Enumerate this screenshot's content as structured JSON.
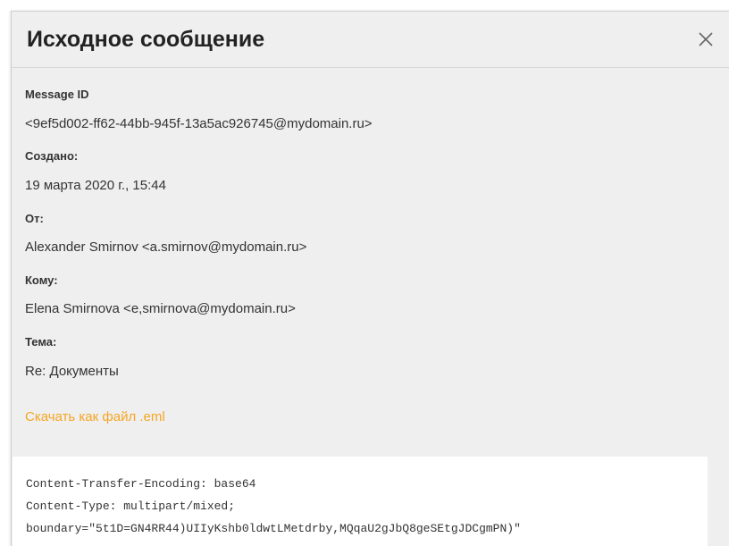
{
  "dialog": {
    "title": "Исходное сообщение",
    "close_icon": "close-icon"
  },
  "fields": {
    "message_id": {
      "label": "Message ID",
      "value": "<9ef5d002-ff62-44bb-945f-13a5ac926745@mydomain.ru>"
    },
    "created": {
      "label": "Создано:",
      "value": "19 марта 2020 г., 15:44"
    },
    "from": {
      "label": "От:",
      "value": "Alexander Smirnov <a.smirnov@mydomain.ru>"
    },
    "to": {
      "label": "Кому:",
      "value": "Elena Smirnova <e,smirnova@mydomain.ru>"
    },
    "subject": {
      "label": "Тема:",
      "value": "Re: Документы"
    }
  },
  "download_link": "Скачать как файл .eml",
  "raw_source": {
    "lines": [
      "Content-Transfer-Encoding: base64",
      "Content-Type: multipart/mixed;",
      "boundary=\"5t1D=GN4RR44)UIIyKshb0ldwtLMetdrby,MQqaU2gJbQ8geSEtgJDCgmPN)\""
    ]
  },
  "colors": {
    "dialog_background": "#efefef",
    "link": "#f5a623",
    "raw_panel_background": "#ffffff"
  }
}
